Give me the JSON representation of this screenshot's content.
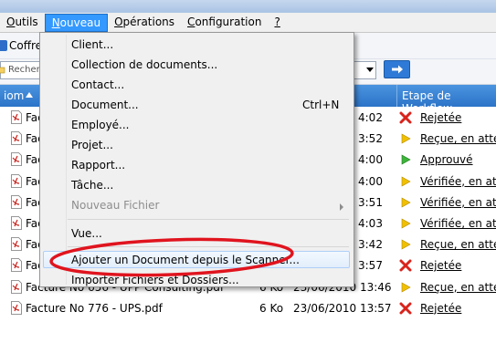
{
  "menubar": {
    "items": [
      {
        "label": "Outils",
        "underline": "O",
        "rest": "utils"
      },
      {
        "label": "Nouveau",
        "underline": "N",
        "rest": "ouveau"
      },
      {
        "label": "Opérations",
        "underline": "O",
        "rest": "pérations"
      },
      {
        "label": "Configuration",
        "underline": "C",
        "rest": "onfiguration"
      },
      {
        "label": "?",
        "underline": "?",
        "rest": ""
      }
    ]
  },
  "toolbar": {
    "vault_label": "Coffre",
    "search_placeholder": "Recherc"
  },
  "header": {
    "name_col": "iom",
    "workflow_col": "Etape de Workflow"
  },
  "rows": [
    {
      "name": "Factu",
      "size": "",
      "date": "4:02",
      "status": "Rejetée",
      "icon": "reject"
    },
    {
      "name": "Factu",
      "size": "",
      "date": "3:52",
      "status": "Reçue, en atten",
      "icon": "pending"
    },
    {
      "name": "Factu",
      "size": "",
      "date": "4:00",
      "status": "Approuvé",
      "icon": "approved"
    },
    {
      "name": "Factu",
      "size": "",
      "date": "4:00",
      "status": "Vérifiée, en atten",
      "icon": "pending"
    },
    {
      "name": "Factu",
      "size": "",
      "date": "3:51",
      "status": "Vérifiée, en atten",
      "icon": "pending"
    },
    {
      "name": "Factu",
      "size": "",
      "date": "4:03",
      "status": "Vérifiée, en atten",
      "icon": "pending"
    },
    {
      "name": "Factu",
      "size": "",
      "date": "3:42",
      "status": "Reçue, en atten",
      "icon": "pending"
    },
    {
      "name": "Factu",
      "size": "",
      "date": "3:57",
      "status": "Rejetée",
      "icon": "reject"
    },
    {
      "name": "Facture No 656 - UPP Consulting.pdf",
      "size": "6 Ko",
      "date": "23/06/2010 13:46",
      "status": "Reçue, en atten",
      "icon": "pending"
    },
    {
      "name": "Facture No 776 - UPS.pdf",
      "size": "6 Ko",
      "date": "23/06/2010 13:57",
      "status": "Rejetée",
      "icon": "reject"
    }
  ],
  "menu": {
    "items": [
      {
        "label": "Client...",
        "shortcut": "",
        "disabled": false,
        "submenu": false
      },
      {
        "label": "Collection de documents...",
        "shortcut": "",
        "disabled": false,
        "submenu": false
      },
      {
        "label": "Contact...",
        "shortcut": "",
        "disabled": false,
        "submenu": false
      },
      {
        "label": "Document...",
        "shortcut": "Ctrl+N",
        "disabled": false,
        "submenu": false
      },
      {
        "label": "Employé...",
        "shortcut": "",
        "disabled": false,
        "submenu": false
      },
      {
        "label": "Projet...",
        "shortcut": "",
        "disabled": false,
        "submenu": false
      },
      {
        "label": "Rapport...",
        "shortcut": "",
        "disabled": false,
        "submenu": false
      },
      {
        "label": "Tâche...",
        "shortcut": "",
        "disabled": false,
        "submenu": false
      },
      {
        "label": "Nouveau Fichier",
        "shortcut": "",
        "disabled": true,
        "submenu": true
      },
      {
        "label": "Vue...",
        "shortcut": "",
        "disabled": false,
        "submenu": false
      },
      {
        "label": "Ajouter un Document depuis le Scanner...",
        "shortcut": "",
        "disabled": false,
        "submenu": false,
        "highlighted": true
      },
      {
        "label": "Importer Fichiers et Dossiers...",
        "shortcut": "",
        "disabled": false,
        "submenu": false
      }
    ]
  },
  "colors": {
    "menu_active": "#3399ff",
    "header_blue": "#2c74c8",
    "annotation_red": "#e0141e",
    "reject_red": "#d8231c",
    "pending_yellow": "#f0c000",
    "approved_green": "#3db43a"
  }
}
